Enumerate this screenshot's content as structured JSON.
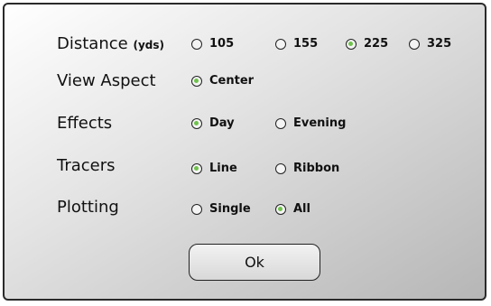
{
  "distance": {
    "label": "Distance",
    "units": "(yds)",
    "options": [
      {
        "label": "105",
        "selected": false
      },
      {
        "label": "155",
        "selected": false
      },
      {
        "label": "225",
        "selected": true
      },
      {
        "label": "325",
        "selected": false
      }
    ]
  },
  "view_aspect": {
    "label": "View Aspect",
    "options": [
      {
        "label": "Center",
        "selected": true
      }
    ]
  },
  "effects": {
    "label": "Effects",
    "options": [
      {
        "label": "Day",
        "selected": true
      },
      {
        "label": "Evening",
        "selected": false
      }
    ]
  },
  "tracers": {
    "label": "Tracers",
    "options": [
      {
        "label": "Line",
        "selected": true
      },
      {
        "label": "Ribbon",
        "selected": false
      }
    ]
  },
  "plotting": {
    "label": "Plotting",
    "options": [
      {
        "label": "Single",
        "selected": false
      },
      {
        "label": "All",
        "selected": true
      }
    ]
  },
  "ok_button": {
    "label": "Ok"
  },
  "colors": {
    "radio_selected": "#6fc24c",
    "border": "#2a2a2a"
  }
}
